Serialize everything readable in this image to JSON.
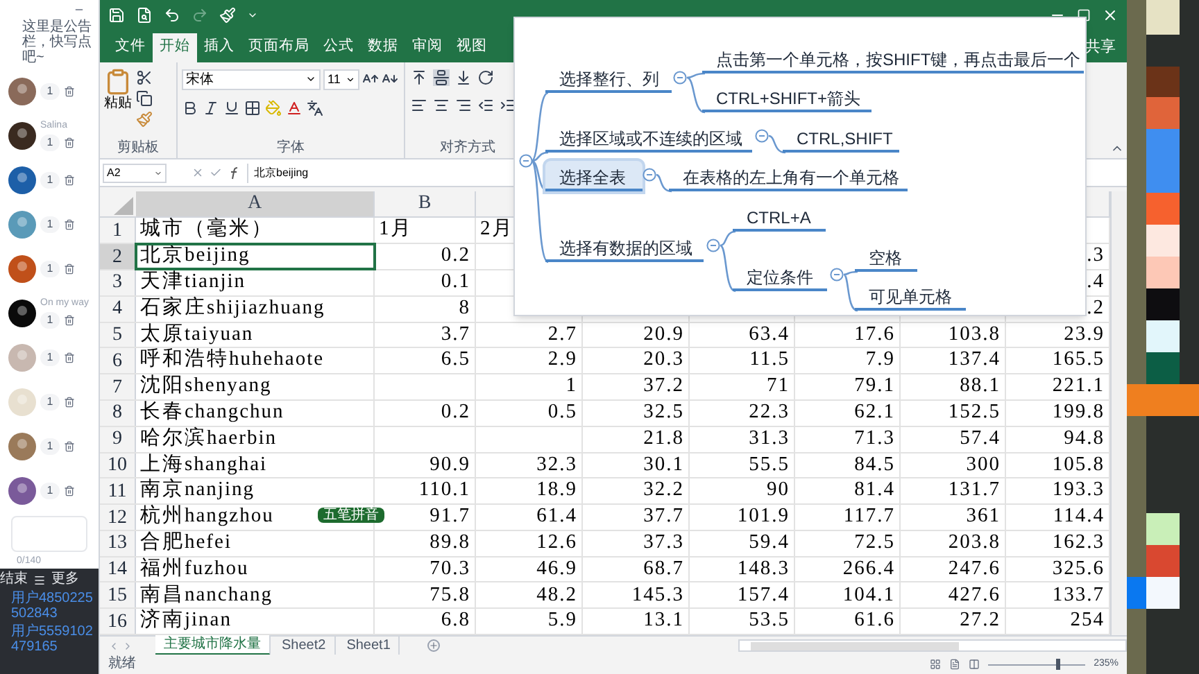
{
  "chat": {
    "notice": "这里是公告栏，快写点吧~",
    "members": [
      {
        "count": "1"
      },
      {
        "name": "Salina",
        "count": "1"
      },
      {
        "count": "1"
      },
      {
        "count": "1"
      },
      {
        "count": "1"
      },
      {
        "name": "On my way",
        "count": "1"
      },
      {
        "count": "1"
      },
      {
        "count": "1"
      },
      {
        "count": "1"
      },
      {
        "count": "1"
      }
    ],
    "counter": "0/140",
    "actions": [
      "结束",
      "更多"
    ],
    "users": [
      "用户4850225502843",
      "用户5559102479165"
    ]
  },
  "excel": {
    "tabs": [
      {
        "label": "文件",
        "selected": false
      },
      {
        "label": "开始",
        "selected": true
      },
      {
        "label": "插入",
        "selected": false
      },
      {
        "label": "页面布局",
        "selected": false
      },
      {
        "label": "公式",
        "selected": false
      },
      {
        "label": "数据",
        "selected": false
      },
      {
        "label": "审阅",
        "selected": false
      },
      {
        "label": "视图",
        "selected": false
      }
    ],
    "share": "共享",
    "ribbon": {
      "paste": "粘贴",
      "font_name": "宋体",
      "font_size": "11",
      "groups": [
        "剪贴板",
        "字体",
        "对齐方式"
      ]
    },
    "name_box": "A2",
    "formula": "北京beijing",
    "columns": [
      {
        "label": "A",
        "selected": true
      },
      {
        "label": "B",
        "selected": false
      }
    ],
    "rows": [
      {
        "number": "1",
        "kind": "header",
        "selected": false,
        "cells": {
          "A": "城市（毫米）",
          "B": "1月",
          "C": "2月"
        }
      },
      {
        "number": "2",
        "kind": "data",
        "selected": true,
        "cells": {
          "A": "北京beijing",
          "B": "0.2",
          "H": ".3"
        }
      },
      {
        "number": "3",
        "kind": "data",
        "selected": false,
        "cells": {
          "A": "天津tianjin",
          "B": "0.1",
          "H": ".4"
        }
      },
      {
        "number": "4",
        "kind": "data",
        "selected": false,
        "cells": {
          "A": "石家庄shijiazhuang",
          "B": "8",
          "H": ".2"
        }
      },
      {
        "number": "5",
        "kind": "data",
        "selected": false,
        "cells": {
          "A": "太原taiyuan",
          "B": "3.7",
          "C": "2.7",
          "D": "20.9",
          "E": "63.4",
          "F": "17.6",
          "G": "103.8",
          "H": "23.9"
        }
      },
      {
        "number": "6",
        "kind": "data",
        "selected": false,
        "cells": {
          "A": "呼和浩特huhehaote",
          "B": "6.5",
          "C": "2.9",
          "D": "20.3",
          "E": "11.5",
          "F": "7.9",
          "G": "137.4",
          "H": "165.5"
        }
      },
      {
        "number": "7",
        "kind": "data",
        "selected": false,
        "cells": {
          "A": "沈阳shenyang",
          "C": "1",
          "D": "37.2",
          "E": "71",
          "F": "79.1",
          "G": "88.1",
          "H": "221.1"
        }
      },
      {
        "number": "8",
        "kind": "data",
        "selected": false,
        "cells": {
          "A": "长春changchun",
          "B": "0.2",
          "C": "0.5",
          "D": "32.5",
          "E": "22.3",
          "F": "62.1",
          "G": "152.5",
          "H": "199.8"
        }
      },
      {
        "number": "9",
        "kind": "data",
        "selected": false,
        "cells": {
          "A": "哈尔滨haerbin",
          "D": "21.8",
          "E": "31.3",
          "F": "71.3",
          "G": "57.4",
          "H": "94.8"
        }
      },
      {
        "number": "10",
        "kind": "data",
        "selected": false,
        "cells": {
          "A": "上海shanghai",
          "B": "90.9",
          "C": "32.3",
          "D": "30.1",
          "E": "55.5",
          "F": "84.5",
          "G": "300",
          "H": "105.8"
        }
      },
      {
        "number": "11",
        "kind": "data",
        "selected": false,
        "cells": {
          "A": "南京nanjing",
          "B": "110.1",
          "C": "18.9",
          "D": "32.2",
          "E": "90",
          "F": "81.4",
          "G": "131.7",
          "H": "193.3"
        }
      },
      {
        "number": "12",
        "kind": "data",
        "selected": false,
        "cells": {
          "A": "杭州hangzhou",
          "B": "91.7",
          "C": "61.4",
          "D": "37.7",
          "E": "101.9",
          "F": "117.7",
          "G": "361",
          "H": "114.4"
        }
      },
      {
        "number": "13",
        "kind": "data",
        "selected": false,
        "cells": {
          "A": "合肥hefei",
          "B": "89.8",
          "C": "12.6",
          "D": "37.3",
          "E": "59.4",
          "F": "72.5",
          "G": "203.8",
          "H": "162.3"
        }
      },
      {
        "number": "14",
        "kind": "data",
        "selected": false,
        "cells": {
          "A": "福州fuzhou",
          "B": "70.3",
          "C": "46.9",
          "D": "68.7",
          "E": "148.3",
          "F": "266.4",
          "G": "247.6",
          "H": "325.6"
        }
      },
      {
        "number": "15",
        "kind": "data",
        "selected": false,
        "cells": {
          "A": "南昌nanchang",
          "B": "75.8",
          "C": "48.2",
          "D": "145.3",
          "E": "157.4",
          "F": "104.1",
          "G": "427.6",
          "H": "133.7"
        }
      },
      {
        "number": "16",
        "kind": "data",
        "selected": false,
        "cells": {
          "A": "济南jinan",
          "B": "6.8",
          "C": "5.9",
          "D": "13.1",
          "E": "53.5",
          "F": "61.6",
          "G": "27.2",
          "H": "254"
        }
      }
    ],
    "ime_indicator": "五笔拼音",
    "sheets": [
      {
        "label": "主要城市降水量",
        "selected": true
      },
      {
        "label": "Sheet2",
        "selected": false
      },
      {
        "label": "Sheet1",
        "selected": false
      }
    ],
    "status": "就绪",
    "zoom": {
      "label": "235%",
      "level": 0.7
    }
  },
  "mind_map": {
    "branches": [
      {
        "label": "选择整行、列",
        "selected": false,
        "children": [
          {
            "label": "点击第一个单元格，按SHIFT键，再点击最后一个",
            "selected": false
          },
          {
            "label": "CTRL+SHIFT+箭头",
            "selected": false
          }
        ]
      },
      {
        "label": "选择区域或不连续的区域",
        "selected": false,
        "children": [
          {
            "label": "CTRL,SHIFT",
            "selected": false
          }
        ]
      },
      {
        "label": "选择全表",
        "selected": true,
        "children": [
          {
            "label": "在表格的左上角有一个单元格",
            "selected": false
          }
        ]
      },
      {
        "label": "选择有数据的区域",
        "selected": false,
        "children": [
          {
            "label": "CTRL+A",
            "selected": false
          },
          {
            "label": "定位条件",
            "selected": false,
            "children": [
              {
                "label": "空格",
                "selected": false
              },
              {
                "label": "可见单元格",
                "selected": false
              }
            ]
          }
        ]
      }
    ]
  }
}
